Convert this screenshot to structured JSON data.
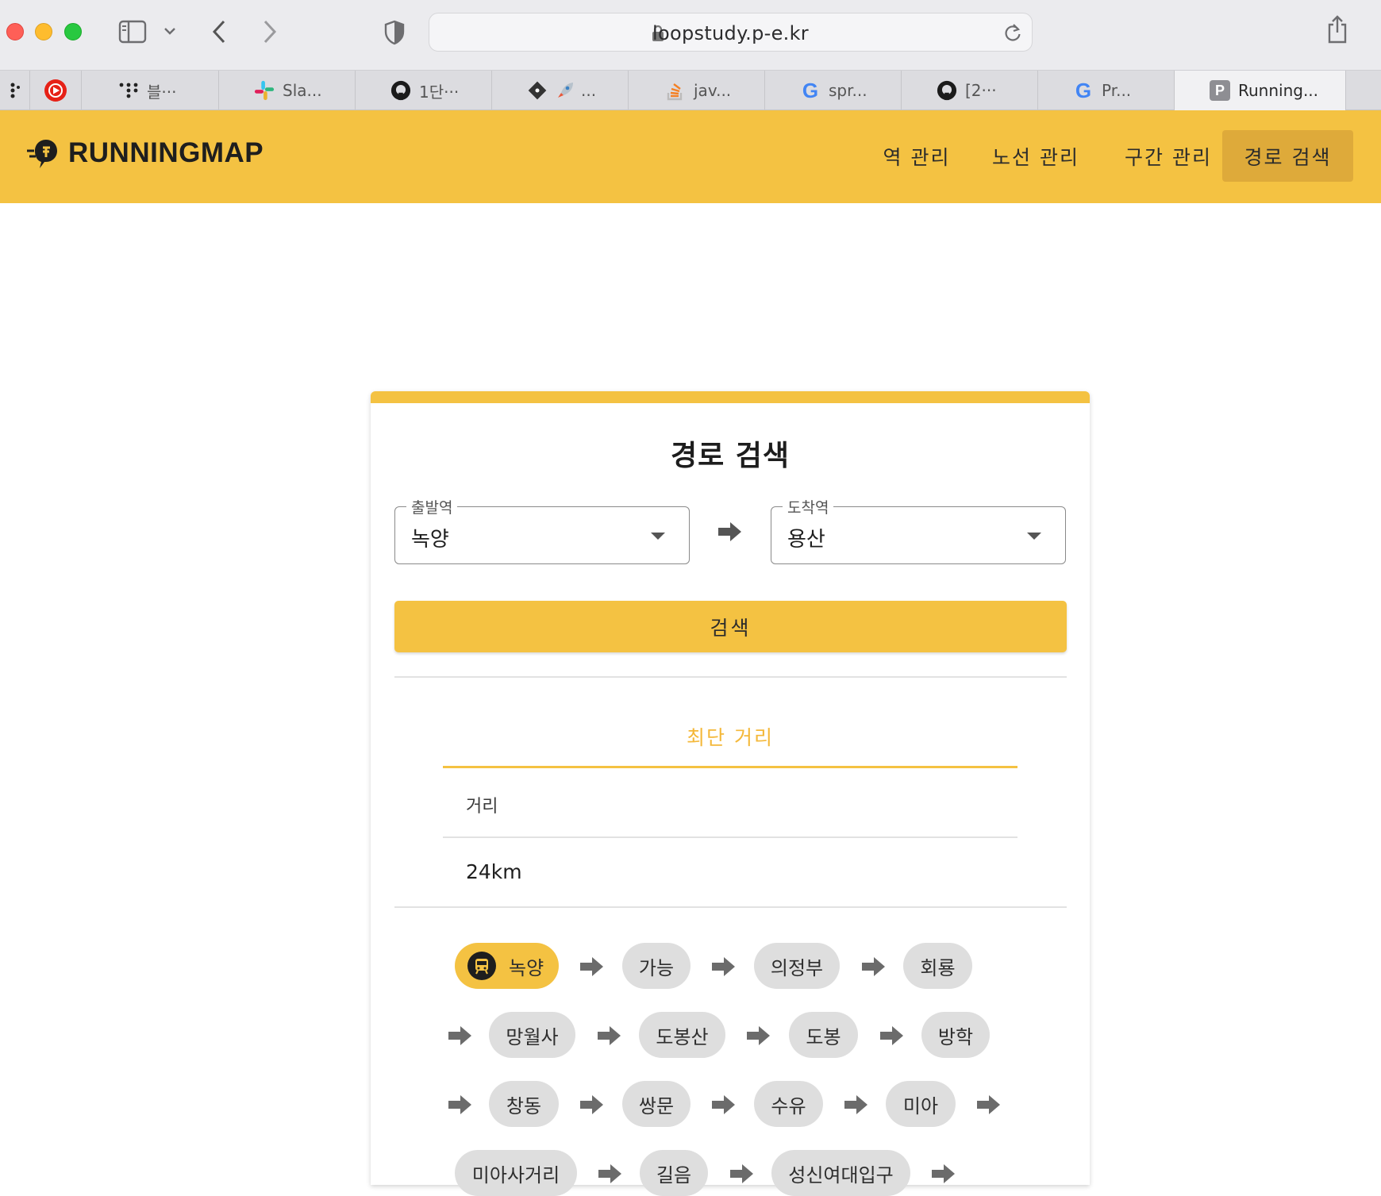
{
  "browser": {
    "url": "loopstudy.p-e.kr",
    "tabs": [
      {
        "label": "",
        "icon": "dots-icon"
      },
      {
        "label": "",
        "icon": "youtube-music-icon"
      },
      {
        "label": "블···",
        "icon": "dots-logo-icon"
      },
      {
        "label": "Sla...",
        "icon": "slack-icon"
      },
      {
        "label": "1단···",
        "icon": "github-icon"
      },
      {
        "label": "...",
        "icon": "git-rocket-icon"
      },
      {
        "label": "jav...",
        "icon": "stackoverflow-icon"
      },
      {
        "label": "spr...",
        "icon": "google-icon"
      },
      {
        "label": "[2···",
        "icon": "github-icon"
      },
      {
        "label": "Pr...",
        "icon": "google-icon"
      },
      {
        "label": "Running...",
        "icon": "p-badge-icon",
        "badge": "P"
      }
    ]
  },
  "app": {
    "brand": "RUNNINGMAP",
    "nav": [
      {
        "label": "역 관리",
        "active": false
      },
      {
        "label": "노선 관리",
        "active": false
      },
      {
        "label": "구간 관리",
        "active": false
      },
      {
        "label": "경로 검색",
        "active": true
      }
    ],
    "accent": "#f4c242"
  },
  "search": {
    "title": "경로 검색",
    "departure": {
      "legend": "출발역",
      "value": "녹양"
    },
    "arrival": {
      "legend": "도착역",
      "value": "용산"
    },
    "button": "검색"
  },
  "result": {
    "tab": "최단 거리",
    "header": "거리",
    "distance": "24km",
    "stations": [
      "녹양",
      "가능",
      "의정부",
      "회룡",
      "망월사",
      "도봉산",
      "도봉",
      "방학",
      "창동",
      "쌍문",
      "수유",
      "미아",
      "미아사거리",
      "길음",
      "성신여대입구"
    ]
  }
}
